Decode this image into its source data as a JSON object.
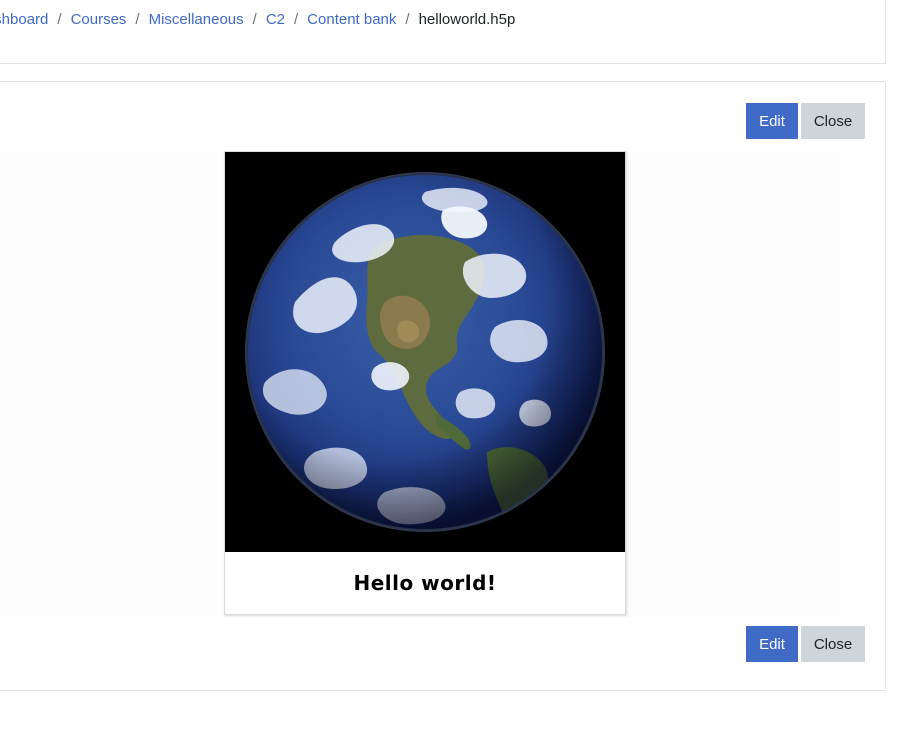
{
  "breadcrumb": {
    "items": [
      {
        "label": "Dashboard"
      },
      {
        "label": "Courses"
      },
      {
        "label": "Miscellaneous"
      },
      {
        "label": "C2"
      },
      {
        "label": "Content bank"
      }
    ],
    "current": "helloworld.h5p",
    "separator": "/"
  },
  "toolbar_top": {
    "edit_label": "Edit",
    "close_label": "Close"
  },
  "toolbar_bottom": {
    "edit_label": "Edit",
    "close_label": "Close"
  },
  "h5p": {
    "image_subject": "earth-globe",
    "caption": "Hello world!"
  },
  "colors": {
    "link": "#3f6ac6",
    "primary_button": "#3f6ac6",
    "secondary_button": "#ced4da",
    "border": "#dee2e6"
  }
}
